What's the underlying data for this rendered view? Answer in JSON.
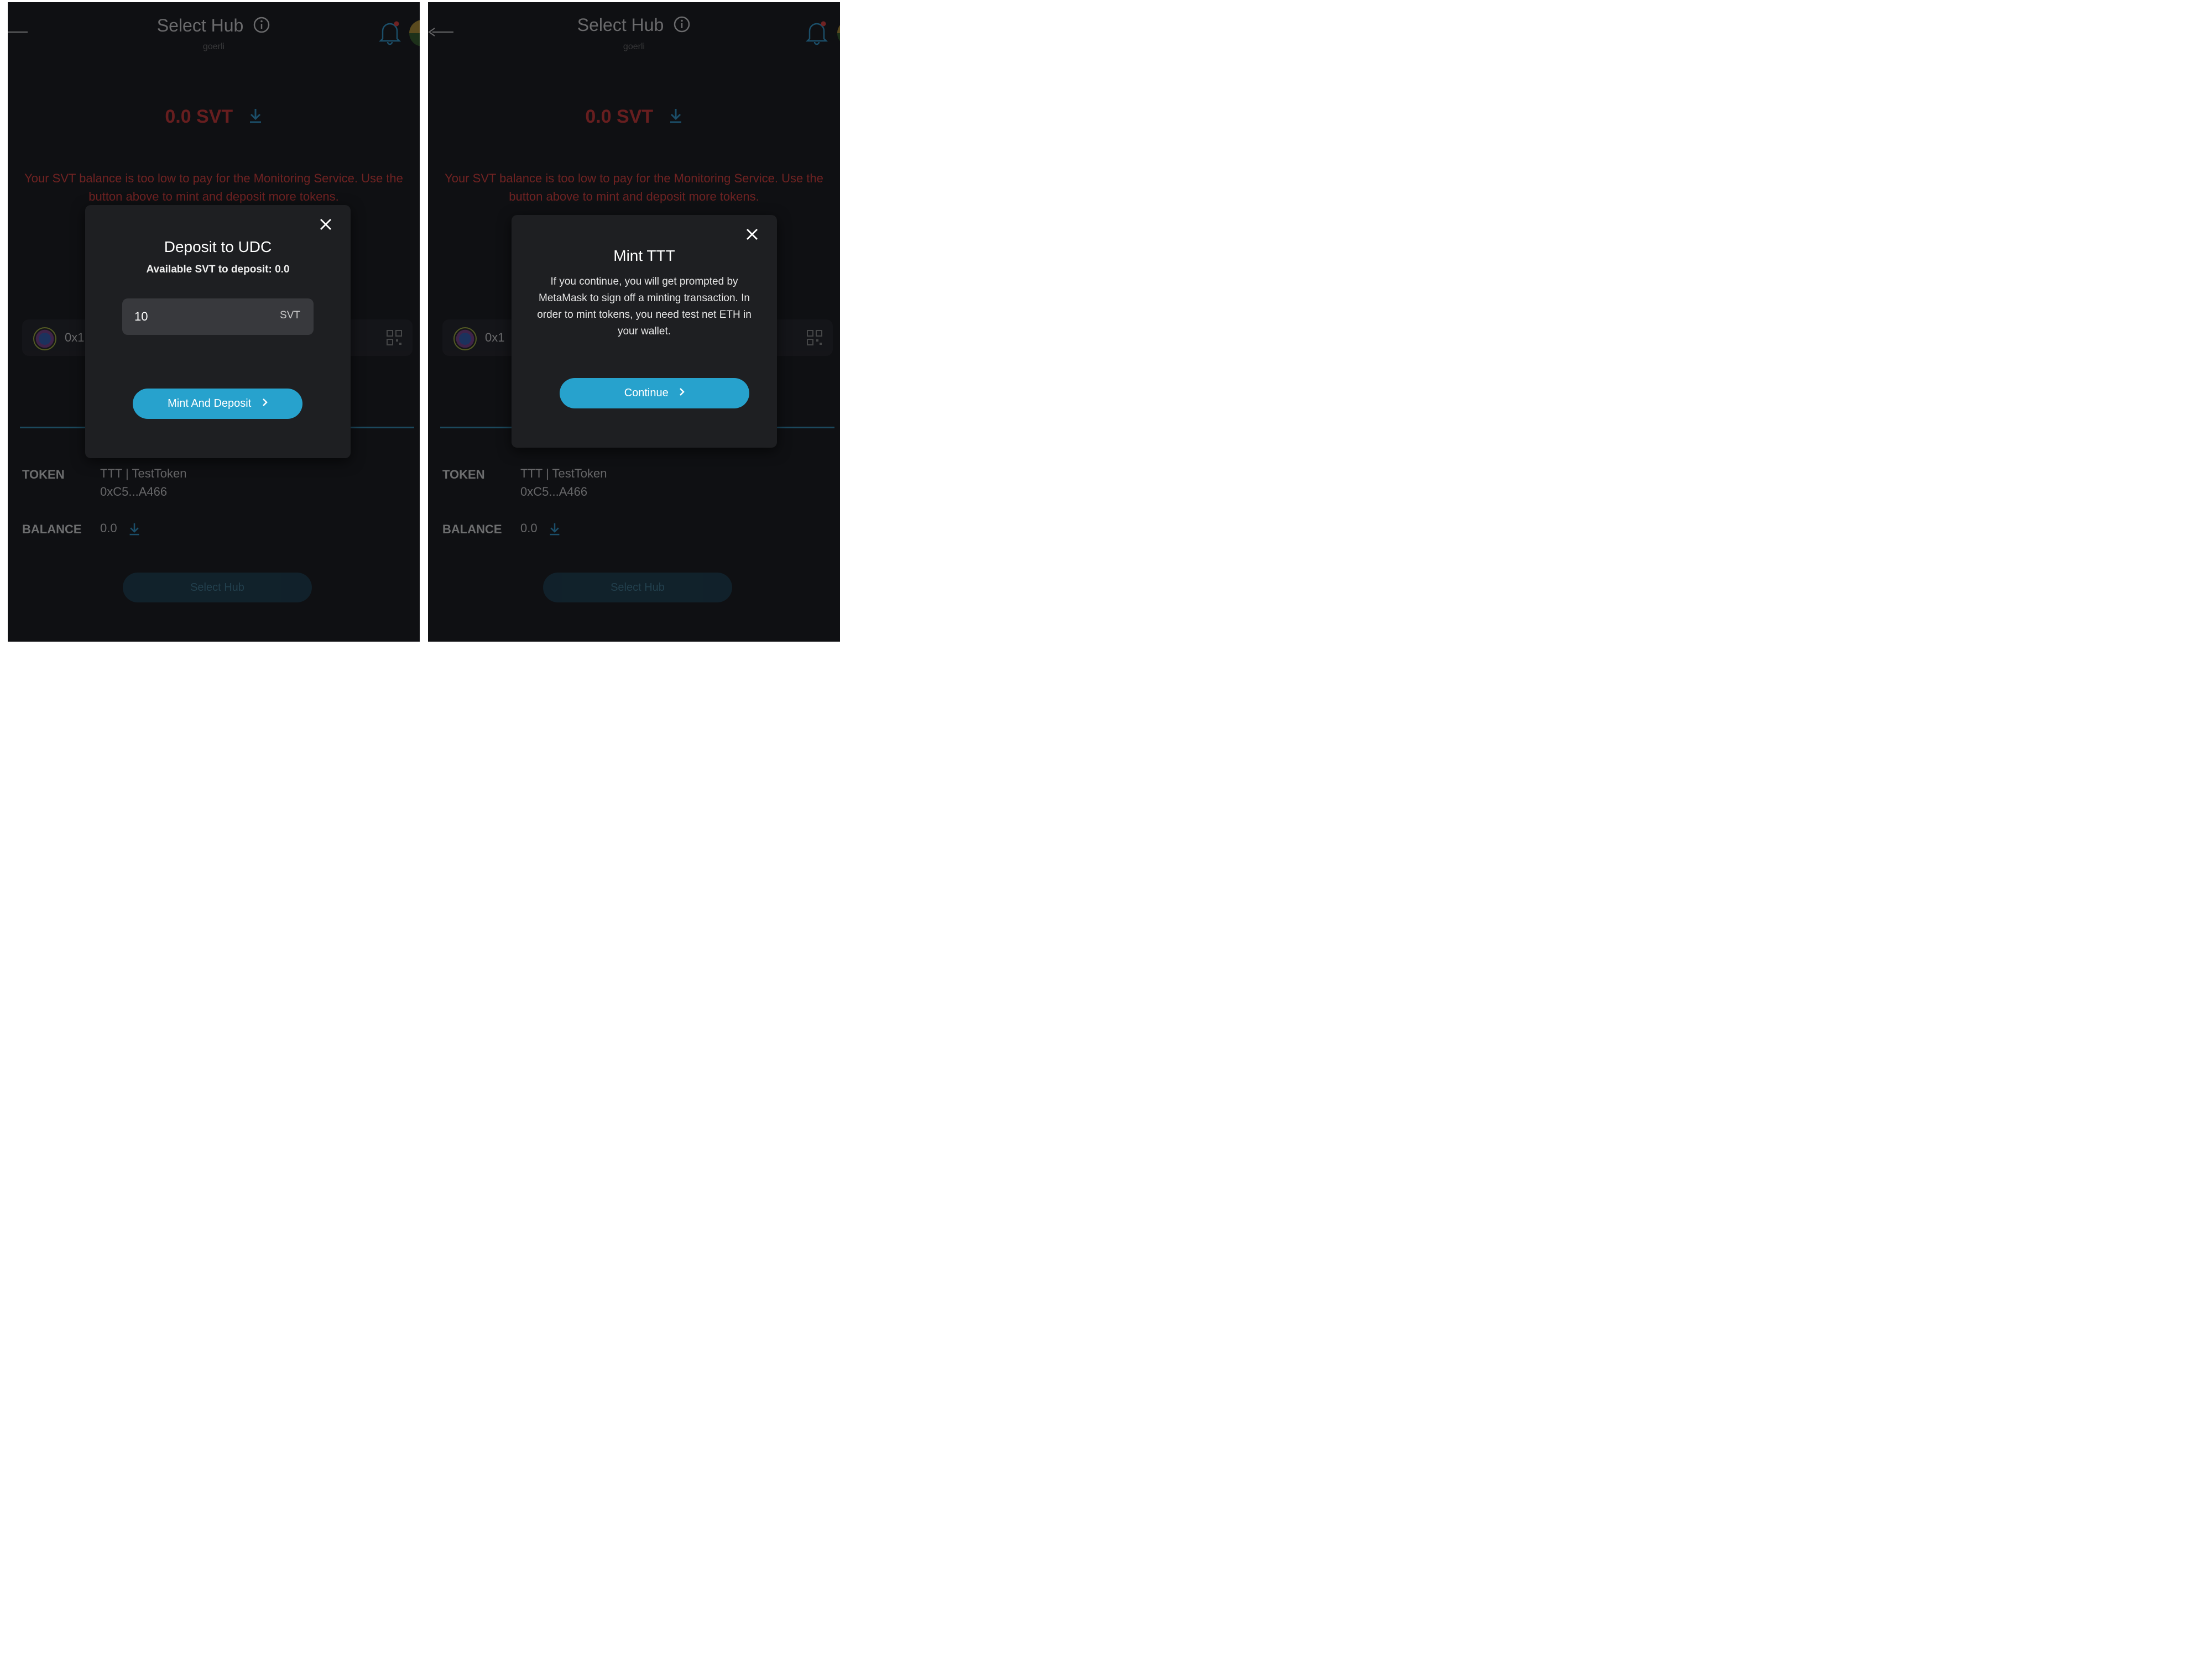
{
  "header": {
    "title": "Select Hub",
    "network": "goerli"
  },
  "balance": {
    "amount": "0.0 SVT"
  },
  "warning": "Your SVT balance is too low to pay for the Monitoring Service. Use the button above to mint and deposit more tokens.",
  "address": {
    "short": "0x1"
  },
  "token": {
    "label": "TOKEN",
    "name": "TTT | TestToken",
    "address": "0xC5...A466"
  },
  "token_balance": {
    "label": "BALANCE",
    "value": "0.0"
  },
  "select_hub_button": "Select Hub",
  "deposit_modal": {
    "title": "Deposit to UDC",
    "subtitle": "Available SVT to deposit: 0.0",
    "amount_value": "10",
    "amount_unit": "SVT",
    "button": "Mint And Deposit"
  },
  "mint_modal": {
    "title": "Mint TTT",
    "body": "If you continue, you will get prompted by MetaMask to sign off a minting transaction. In order to mint tokens, you need test net ETH in your wallet.",
    "button": "Continue"
  },
  "colors": {
    "background": "#0f1013",
    "modal": "#1e1f22",
    "accent": "#27a2cd",
    "error": "#e53935"
  },
  "icons": [
    "back-arrow-icon",
    "info-icon",
    "bell-icon",
    "download-icon",
    "qr-code-icon",
    "close-icon",
    "chevron-right-icon"
  ]
}
